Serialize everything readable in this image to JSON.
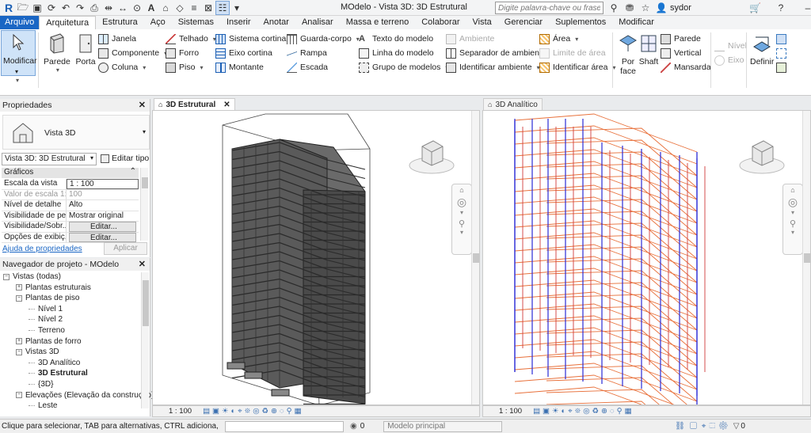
{
  "app": {
    "title": "MOdelo - Vista 3D: 3D Estrutural",
    "search_placeholder": "Digite palavra-chave ou frase",
    "user": "sydor"
  },
  "menu_tabs": [
    "Arquivo",
    "Arquitetura",
    "Estrutura",
    "Aço",
    "Sistemas",
    "Inserir",
    "Anotar",
    "Analisar",
    "Massa e terreno",
    "Colaborar",
    "Vista",
    "Gerenciar",
    "Suplementos",
    "Modificar"
  ],
  "ribbon": {
    "modify": "Modificar",
    "wall": "Parede",
    "door": "Porta",
    "window": "Janela",
    "component": "Componente",
    "column": "Coluna",
    "roof": "Telhado",
    "ceiling": "Forro",
    "floor": "Piso",
    "curtain_system": "Sistema cortina",
    "curtain_grid": "Eixo cortina",
    "mullion": "Montante",
    "railing": "Guarda-corpo",
    "ramp": "Rampa",
    "stair": "Escada",
    "model_text": "Texto do modelo",
    "model_line": "Linha do modelo",
    "model_group": "Grupo de modelos",
    "room": "Ambiente",
    "room_separator": "Separador de ambiente",
    "tag_room": "Identificar ambiente",
    "area": "Área",
    "area_boundary": "Limite de área",
    "tag_area": "Identificar área",
    "by_face_1": "Por",
    "by_face_2": "face",
    "shaft": "Shaft",
    "wall_opening": "Parede",
    "vertical": "Vertical",
    "dormer": "Mansarda",
    "level": "Nível",
    "grid": "Eixo",
    "set": "Definir"
  },
  "properties": {
    "title": "Propriedades",
    "type_name": "Vista 3D",
    "view_selector": "Vista 3D: 3D Estrutural",
    "edit_type": "Editar tipo",
    "section": "Gráficos",
    "rows": [
      {
        "k": "Escala da vista",
        "v": "1 : 100"
      },
      {
        "k": "Valor de escala   1:",
        "v": "100"
      },
      {
        "k": "Nível de detalhe",
        "v": "Alto"
      },
      {
        "k": "Visibilidade de pe...",
        "v": "Mostrar original"
      },
      {
        "k": "Visibilidade/Sobr...",
        "v": "Editar..."
      },
      {
        "k": "Opções de exibiç...",
        "v": "Editar..."
      }
    ],
    "help": "Ajuda de propriedades",
    "apply": "Aplicar"
  },
  "browser": {
    "title": "Navegador de projeto - MOdelo",
    "items": [
      {
        "t": "Vistas (todas)",
        "lvl": 0,
        "pm": "−"
      },
      {
        "t": "Plantas estruturais",
        "lvl": 1,
        "pm": "+"
      },
      {
        "t": "Plantas de piso",
        "lvl": 1,
        "pm": "−"
      },
      {
        "t": "Nível 1",
        "lvl": 2,
        "pm": ""
      },
      {
        "t": "Nível 2",
        "lvl": 2,
        "pm": ""
      },
      {
        "t": "Terreno",
        "lvl": 2,
        "pm": ""
      },
      {
        "t": "Plantas de forro",
        "lvl": 1,
        "pm": "+"
      },
      {
        "t": "Vistas 3D",
        "lvl": 1,
        "pm": "−"
      },
      {
        "t": "3D Analítico",
        "lvl": 2,
        "pm": ""
      },
      {
        "t": "3D Estrutural",
        "lvl": 2,
        "pm": "",
        "bold": true
      },
      {
        "t": "{3D}",
        "lvl": 2,
        "pm": ""
      },
      {
        "t": "Elevações (Elevação da construção)",
        "lvl": 1,
        "pm": "−"
      },
      {
        "t": "Leste",
        "lvl": 2,
        "pm": ""
      }
    ]
  },
  "views": {
    "left_tab": "3D Estrutural",
    "right_tab": "3D Analítico",
    "left_scale": "1 : 100",
    "right_scale": "1 : 100"
  },
  "status": {
    "hint": "Clique para selecionar, TAB para alternativas, CTRL adiciona, SHIF",
    "workset_count": "0",
    "model": "Modelo principal",
    "filter_count": "0"
  }
}
